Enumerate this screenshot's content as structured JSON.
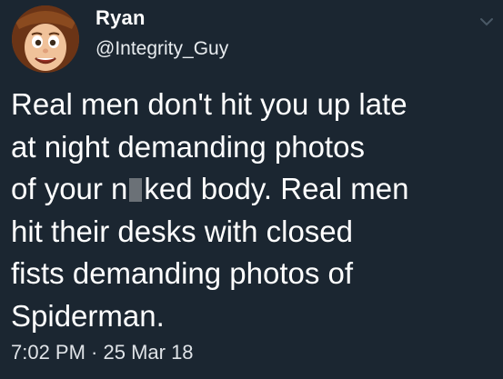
{
  "author": {
    "name": "Ryan",
    "handle": "@Integrity_Guy",
    "avatar_icon": "woody-cowboy-avatar"
  },
  "tweet": {
    "line1": "Real men don't hit you up late",
    "line2": "at night demanding photos",
    "line3_before": "of your n",
    "line3_after": "ked body. Real men",
    "line4": "hit their desks with closed",
    "line5": "fists demanding photos of",
    "line6": "Spiderman.",
    "redaction_color": "#6b7177"
  },
  "meta": {
    "timestamp": "7:02 PM · 25 Mar 18"
  },
  "menu_icon": "chevron-down-icon",
  "colors": {
    "background": "#1b2631",
    "text": "#ffffff"
  }
}
